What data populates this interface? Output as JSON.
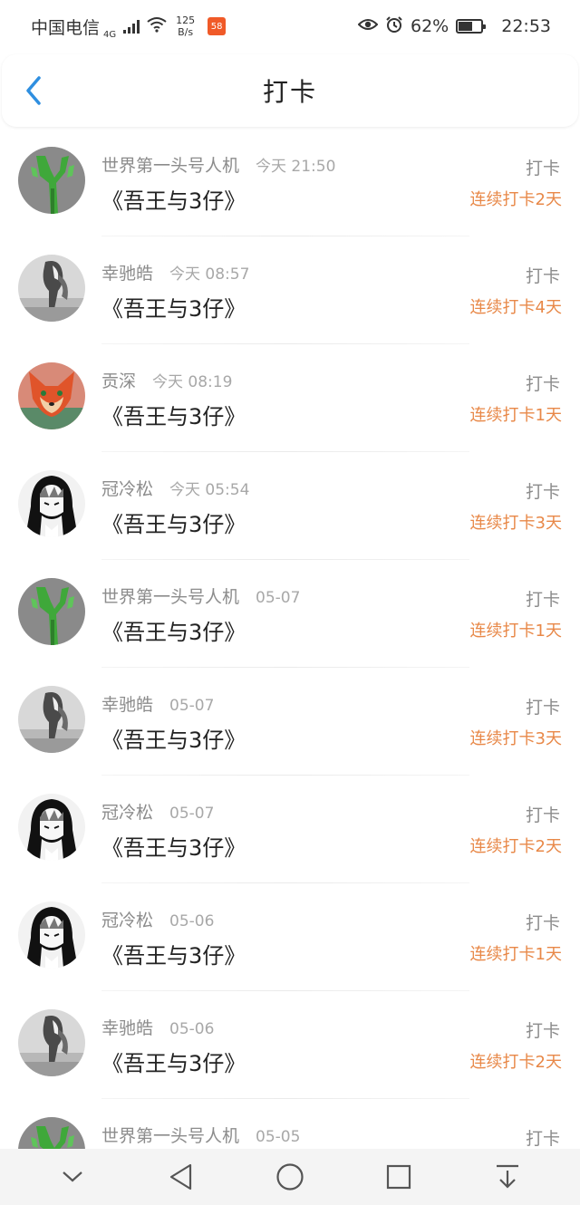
{
  "status_bar": {
    "carrier": "中国电信",
    "network": "4G",
    "speed_value": "125",
    "speed_unit": "B/s",
    "app_badge": "58",
    "battery": "62%",
    "battery_level": 0.62,
    "time": "22:53"
  },
  "nav": {
    "title": "打卡"
  },
  "items": [
    {
      "user": "世界第一头号人机",
      "time": "今天 21:50",
      "book": "《吾王与3仔》",
      "type": "打卡",
      "streak": "连续打卡2天",
      "avatar": "green-sprout"
    },
    {
      "user": "幸驰皓",
      "time": "今天 08:57",
      "book": "《吾王与3仔》",
      "type": "打卡",
      "streak": "连续打卡4天",
      "avatar": "gray-girl"
    },
    {
      "user": "贡深",
      "time": "今天 08:19",
      "book": "《吾王与3仔》",
      "type": "打卡",
      "streak": "连续打卡1天",
      "avatar": "fox"
    },
    {
      "user": "冠冷松",
      "time": "今天 05:54",
      "book": "《吾王与3仔》",
      "type": "打卡",
      "streak": "连续打卡3天",
      "avatar": "anime-bw"
    },
    {
      "user": "世界第一头号人机",
      "time": "05-07",
      "book": "《吾王与3仔》",
      "type": "打卡",
      "streak": "连续打卡1天",
      "avatar": "green-sprout"
    },
    {
      "user": "幸驰皓",
      "time": "05-07",
      "book": "《吾王与3仔》",
      "type": "打卡",
      "streak": "连续打卡3天",
      "avatar": "gray-girl"
    },
    {
      "user": "冠冷松",
      "time": "05-07",
      "book": "《吾王与3仔》",
      "type": "打卡",
      "streak": "连续打卡2天",
      "avatar": "anime-bw"
    },
    {
      "user": "冠冷松",
      "time": "05-06",
      "book": "《吾王与3仔》",
      "type": "打卡",
      "streak": "连续打卡1天",
      "avatar": "anime-bw"
    },
    {
      "user": "幸驰皓",
      "time": "05-06",
      "book": "《吾王与3仔》",
      "type": "打卡",
      "streak": "连续打卡2天",
      "avatar": "gray-girl"
    },
    {
      "user": "世界第一头号人机",
      "time": "05-05",
      "book": "",
      "type": "打卡",
      "streak": "",
      "avatar": "green-sprout"
    }
  ],
  "colors": {
    "accent": "#2f8fe0",
    "streak": "#e88848",
    "muted_text": "#8c8c8c"
  },
  "system_nav": {
    "icons": [
      "chevron-down-icon",
      "back-triangle-icon",
      "home-circle-icon",
      "recents-square-icon",
      "notification-pull-icon"
    ]
  }
}
